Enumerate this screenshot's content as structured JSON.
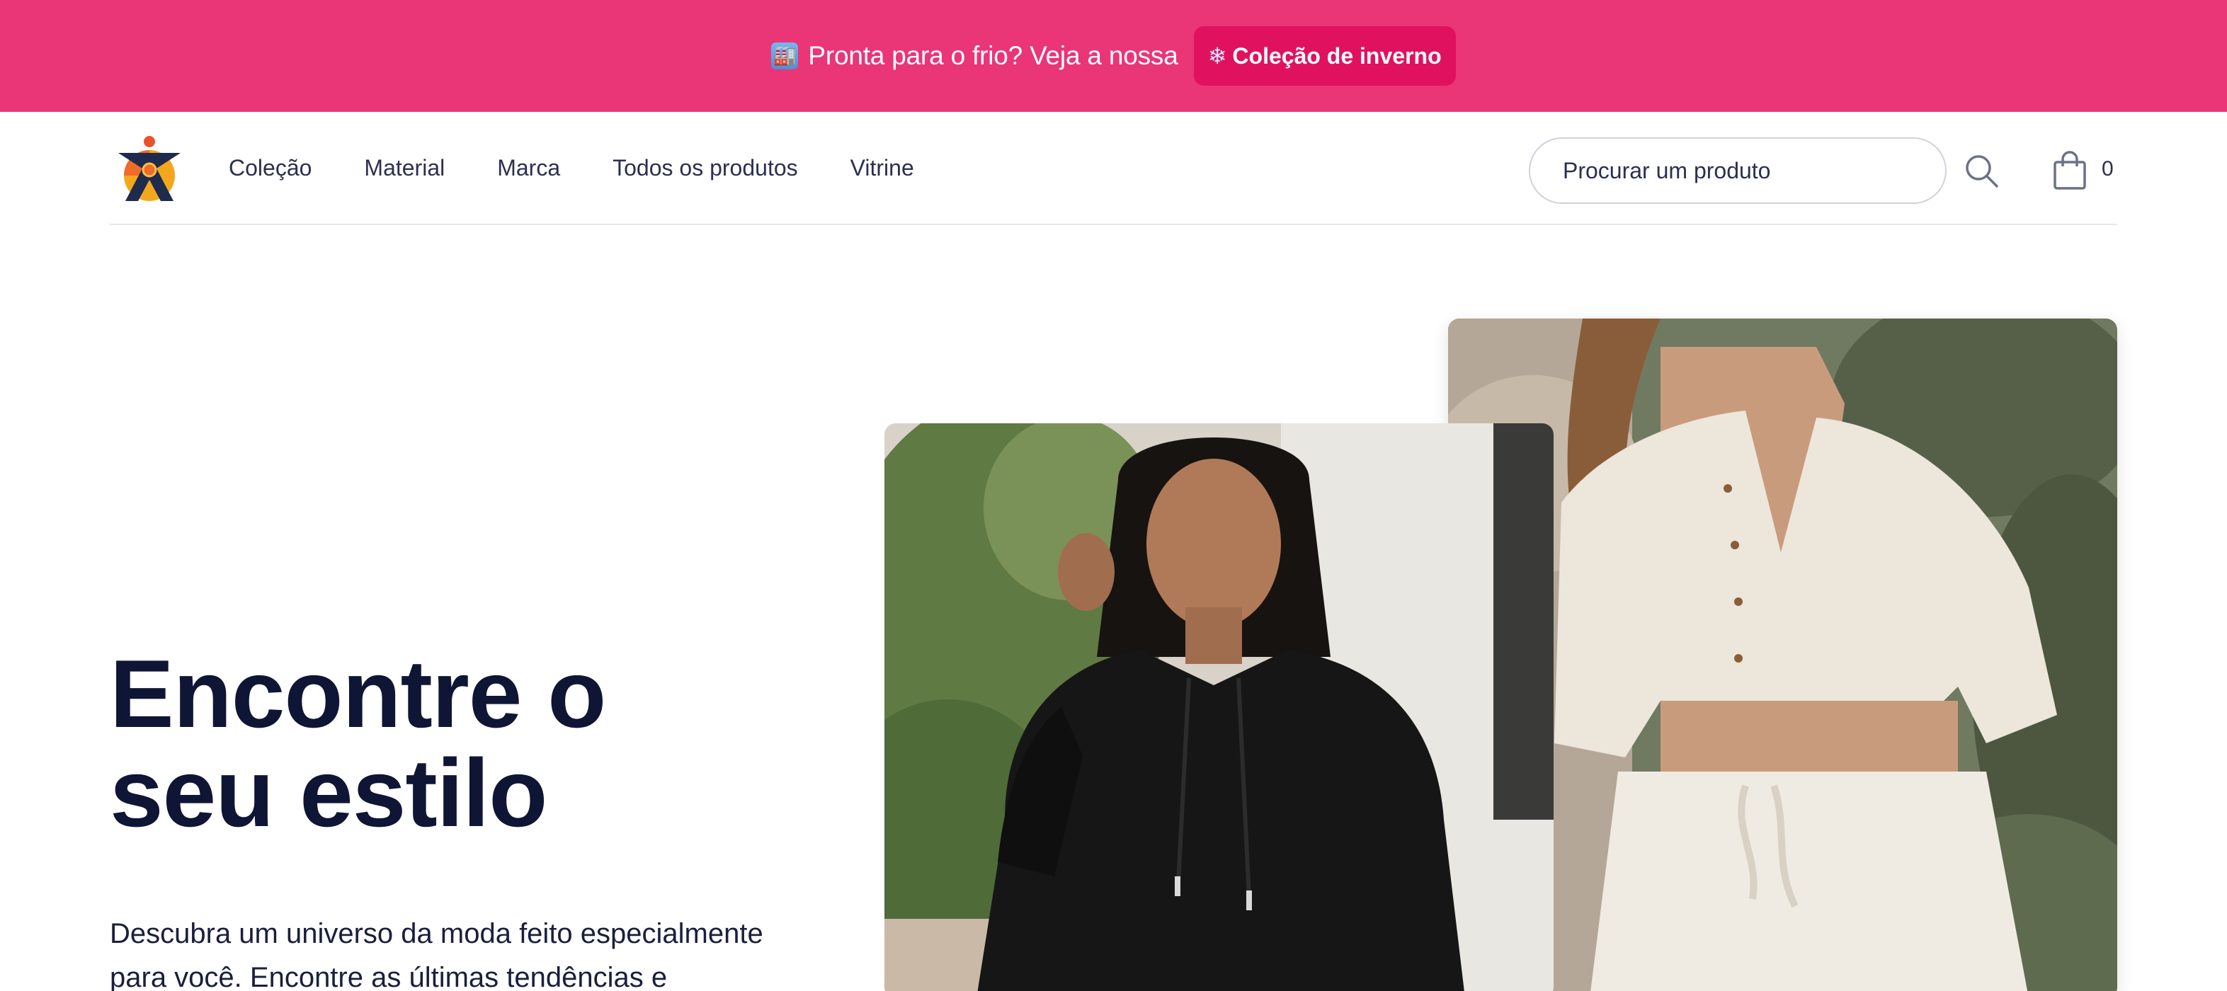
{
  "announcement": {
    "emoji": "🏭",
    "text": "Pronta para o frio? Veja a nossa",
    "cta_icon": "❄",
    "cta_label": "Coleção de inverno"
  },
  "header": {
    "logo_icon": "brand-logo-icon",
    "nav": [
      "Coleção",
      "Material",
      "Marca",
      "Todos os produtos",
      "Vitrine"
    ],
    "search_placeholder": "Procurar um produto",
    "cart_count": "0"
  },
  "hero": {
    "title_line1": "Encontre o",
    "title_line2": "seu estilo",
    "description_line1": "Descubra um universo da moda feito especialmente",
    "description_line2": "para você. Encontre as últimas tendências e"
  },
  "colors": {
    "announcement_bg": "#ea3577",
    "cta_bg": "#e0125f",
    "title": "#0f1535"
  },
  "images": [
    {
      "name": "hero-photo-black-hoodie",
      "subject": "woman in black hoodie"
    },
    {
      "name": "hero-photo-linen-outfit",
      "subject": "woman in white linen shirt and trousers"
    }
  ]
}
